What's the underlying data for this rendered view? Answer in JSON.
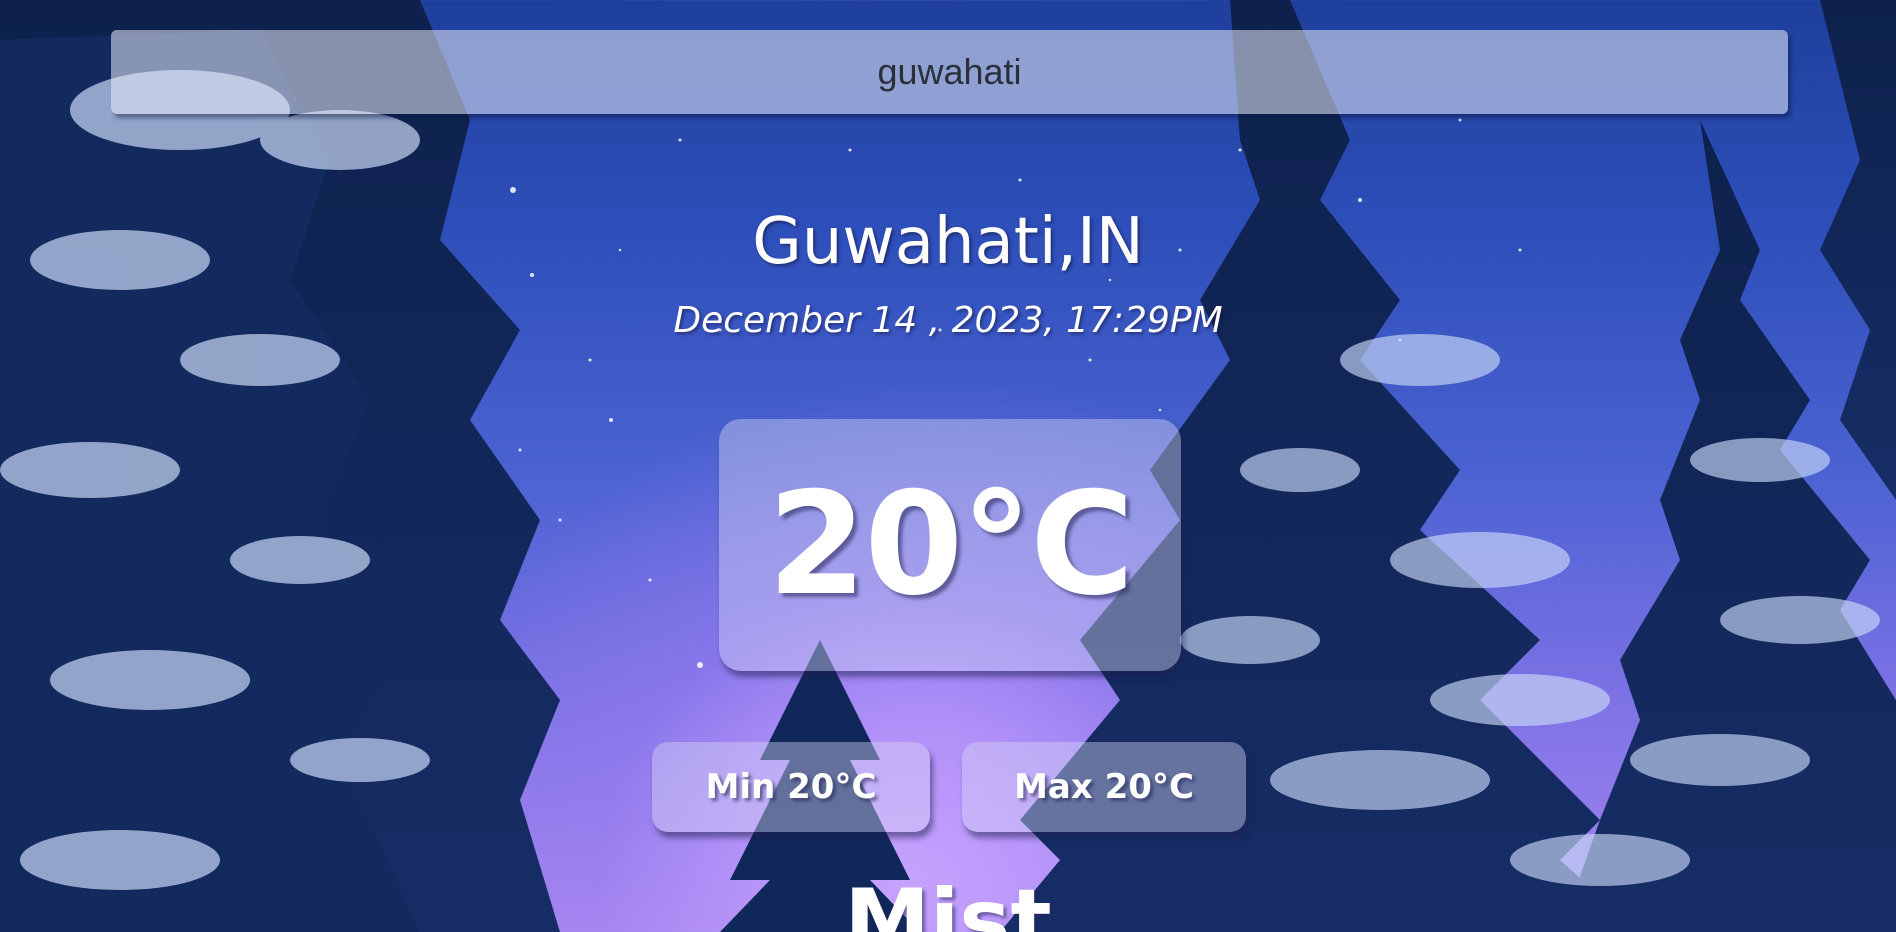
{
  "search": {
    "value": "guwahati"
  },
  "location": {
    "city": "Guwahati,IN",
    "datetime": "December 14 , 2023, 17:29PM"
  },
  "weather": {
    "temperature": "20°C",
    "min": "Min 20°C",
    "max": "Max 20°C",
    "condition": "Mist"
  },
  "colors": {
    "sky_top": "#1f3f9c",
    "sky_glow": "#c7a2ff",
    "tree_dark": "#0f2450",
    "snow": "#d9e6ff"
  }
}
